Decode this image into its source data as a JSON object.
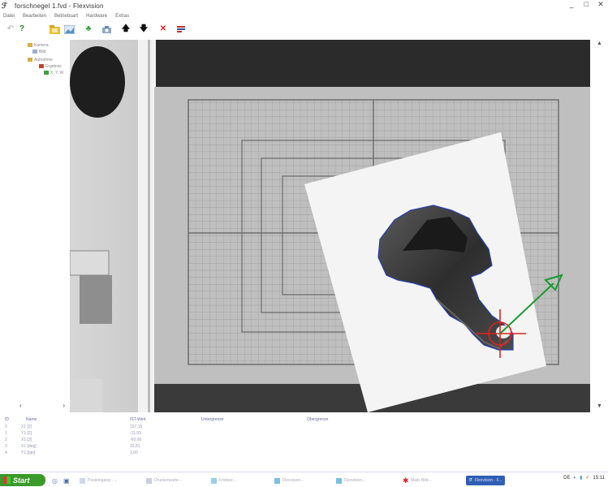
{
  "window": {
    "title": "forschnegel 1.fvd - Flexvision",
    "controls": [
      "_",
      "□",
      "✕"
    ]
  },
  "menu": [
    "Datei",
    "Bearbeiten",
    "Betriebsart",
    "Hardware",
    "Extras"
  ],
  "toolbar": {
    "icons": [
      "undo-icon",
      "help-icon",
      "open-icon",
      "image-icon",
      "run-icon",
      "camera-icon",
      "arrow-up-icon",
      "arrow-down-icon",
      "delete-icon",
      "settings-icon"
    ]
  },
  "tree": {
    "items": [
      "Kamera",
      "Bild",
      "Aufnahme",
      "Ergebnis",
      "X, Y, W"
    ]
  },
  "results": {
    "headers": [
      "ID",
      "Name",
      "IST-Wert",
      "Untergrenze",
      "Obergrenze"
    ],
    "rows": [
      [
        "0",
        "X1 [2]",
        "157,15",
        "",
        ""
      ],
      [
        "1",
        "Y1 [2]",
        "-11,93",
        "",
        ""
      ],
      [
        "2",
        "X1 [3]",
        "-60,00",
        "",
        ""
      ],
      [
        "3",
        "X1 [deg]",
        "33,81",
        "",
        ""
      ],
      [
        "4",
        "Y1 [ppi]",
        "1,00",
        "",
        ""
      ]
    ]
  },
  "taskbar": {
    "start_label": "Start",
    "tasks": [
      "Posteingang - ...",
      "Druckerwarte...",
      "Frisbee...",
      "Flexvision...",
      "Flexvision...",
      "Mails Bild...",
      "Flexvision - F..."
    ],
    "clock": "15:11",
    "lang": "DE"
  },
  "colors": {
    "contour": "#2a3fb0",
    "crosshair": "#e02020",
    "orientation_arrow": "#1a9a30",
    "start_button": "#3a9a2a"
  }
}
